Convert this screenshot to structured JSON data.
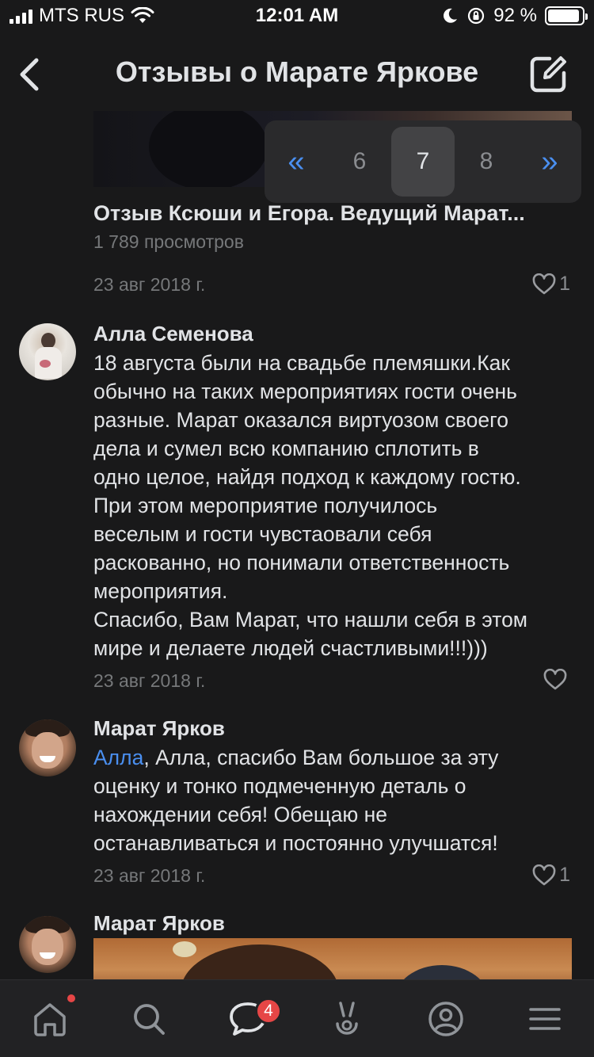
{
  "status_bar": {
    "carrier": "MTS RUS",
    "time": "12:01 AM",
    "battery_percent": "92 %",
    "battery_level": 0.92
  },
  "header": {
    "title": "Отзывы о Марате Яркове",
    "back_icon": "chevron-left-icon",
    "edit_icon": "edit-icon"
  },
  "pagination": {
    "prev_icon": "double-chevron-left-icon",
    "pages": [
      "6",
      "7",
      "8"
    ],
    "current": "7",
    "next_icon": "double-chevron-right-icon"
  },
  "video": {
    "title": "Отзыв Ксюши и Егора. Ведущий Марат...",
    "views": "1 789 просмотров",
    "date": "23 авг 2018 г.",
    "likes": "1"
  },
  "comments": [
    {
      "author": "Алла Семенова",
      "text": "18 августа были на свадьбе племяшки.Как\nобычно на таких мероприятиях гости очень\nразные. Марат оказался виртуозом своего\nдела и сумел всю компанию сплотить в\nодно целое, найдя подход к каждому гостю.\nПри этом мероприятие получилось\nвеселым и гости чувстаовали себя\nраскованно, но понимали ответственность\nмероприятия.\nСпасибо, Вам Марат, что нашли себя в этом\nмире и делаете людей счастливыми!!!)))",
      "date": "23 авг 2018 г.",
      "likes": ""
    },
    {
      "author": "Марат Ярков",
      "mention": "Алла",
      "text": ", Алла, спасибо Вам большое за эту\nоценку и тонко подмеченную деталь о\nнахождении себя! Обещаю не\nостанавливаться и постоянно улучшатся!",
      "date": "23 авг 2018 г.",
      "likes": "1"
    },
    {
      "author": "Марат Ярков"
    }
  ],
  "tab_bar": {
    "items": [
      "home-icon",
      "search-icon",
      "messages-icon",
      "clips-icon",
      "profile-icon",
      "menu-icon"
    ],
    "messages_badge": "4"
  },
  "colors": {
    "background": "#19191a",
    "accent": "#4a8ff0",
    "badge": "#e64646",
    "text": "#e1e3e6",
    "secondary_text": "#76787a"
  }
}
